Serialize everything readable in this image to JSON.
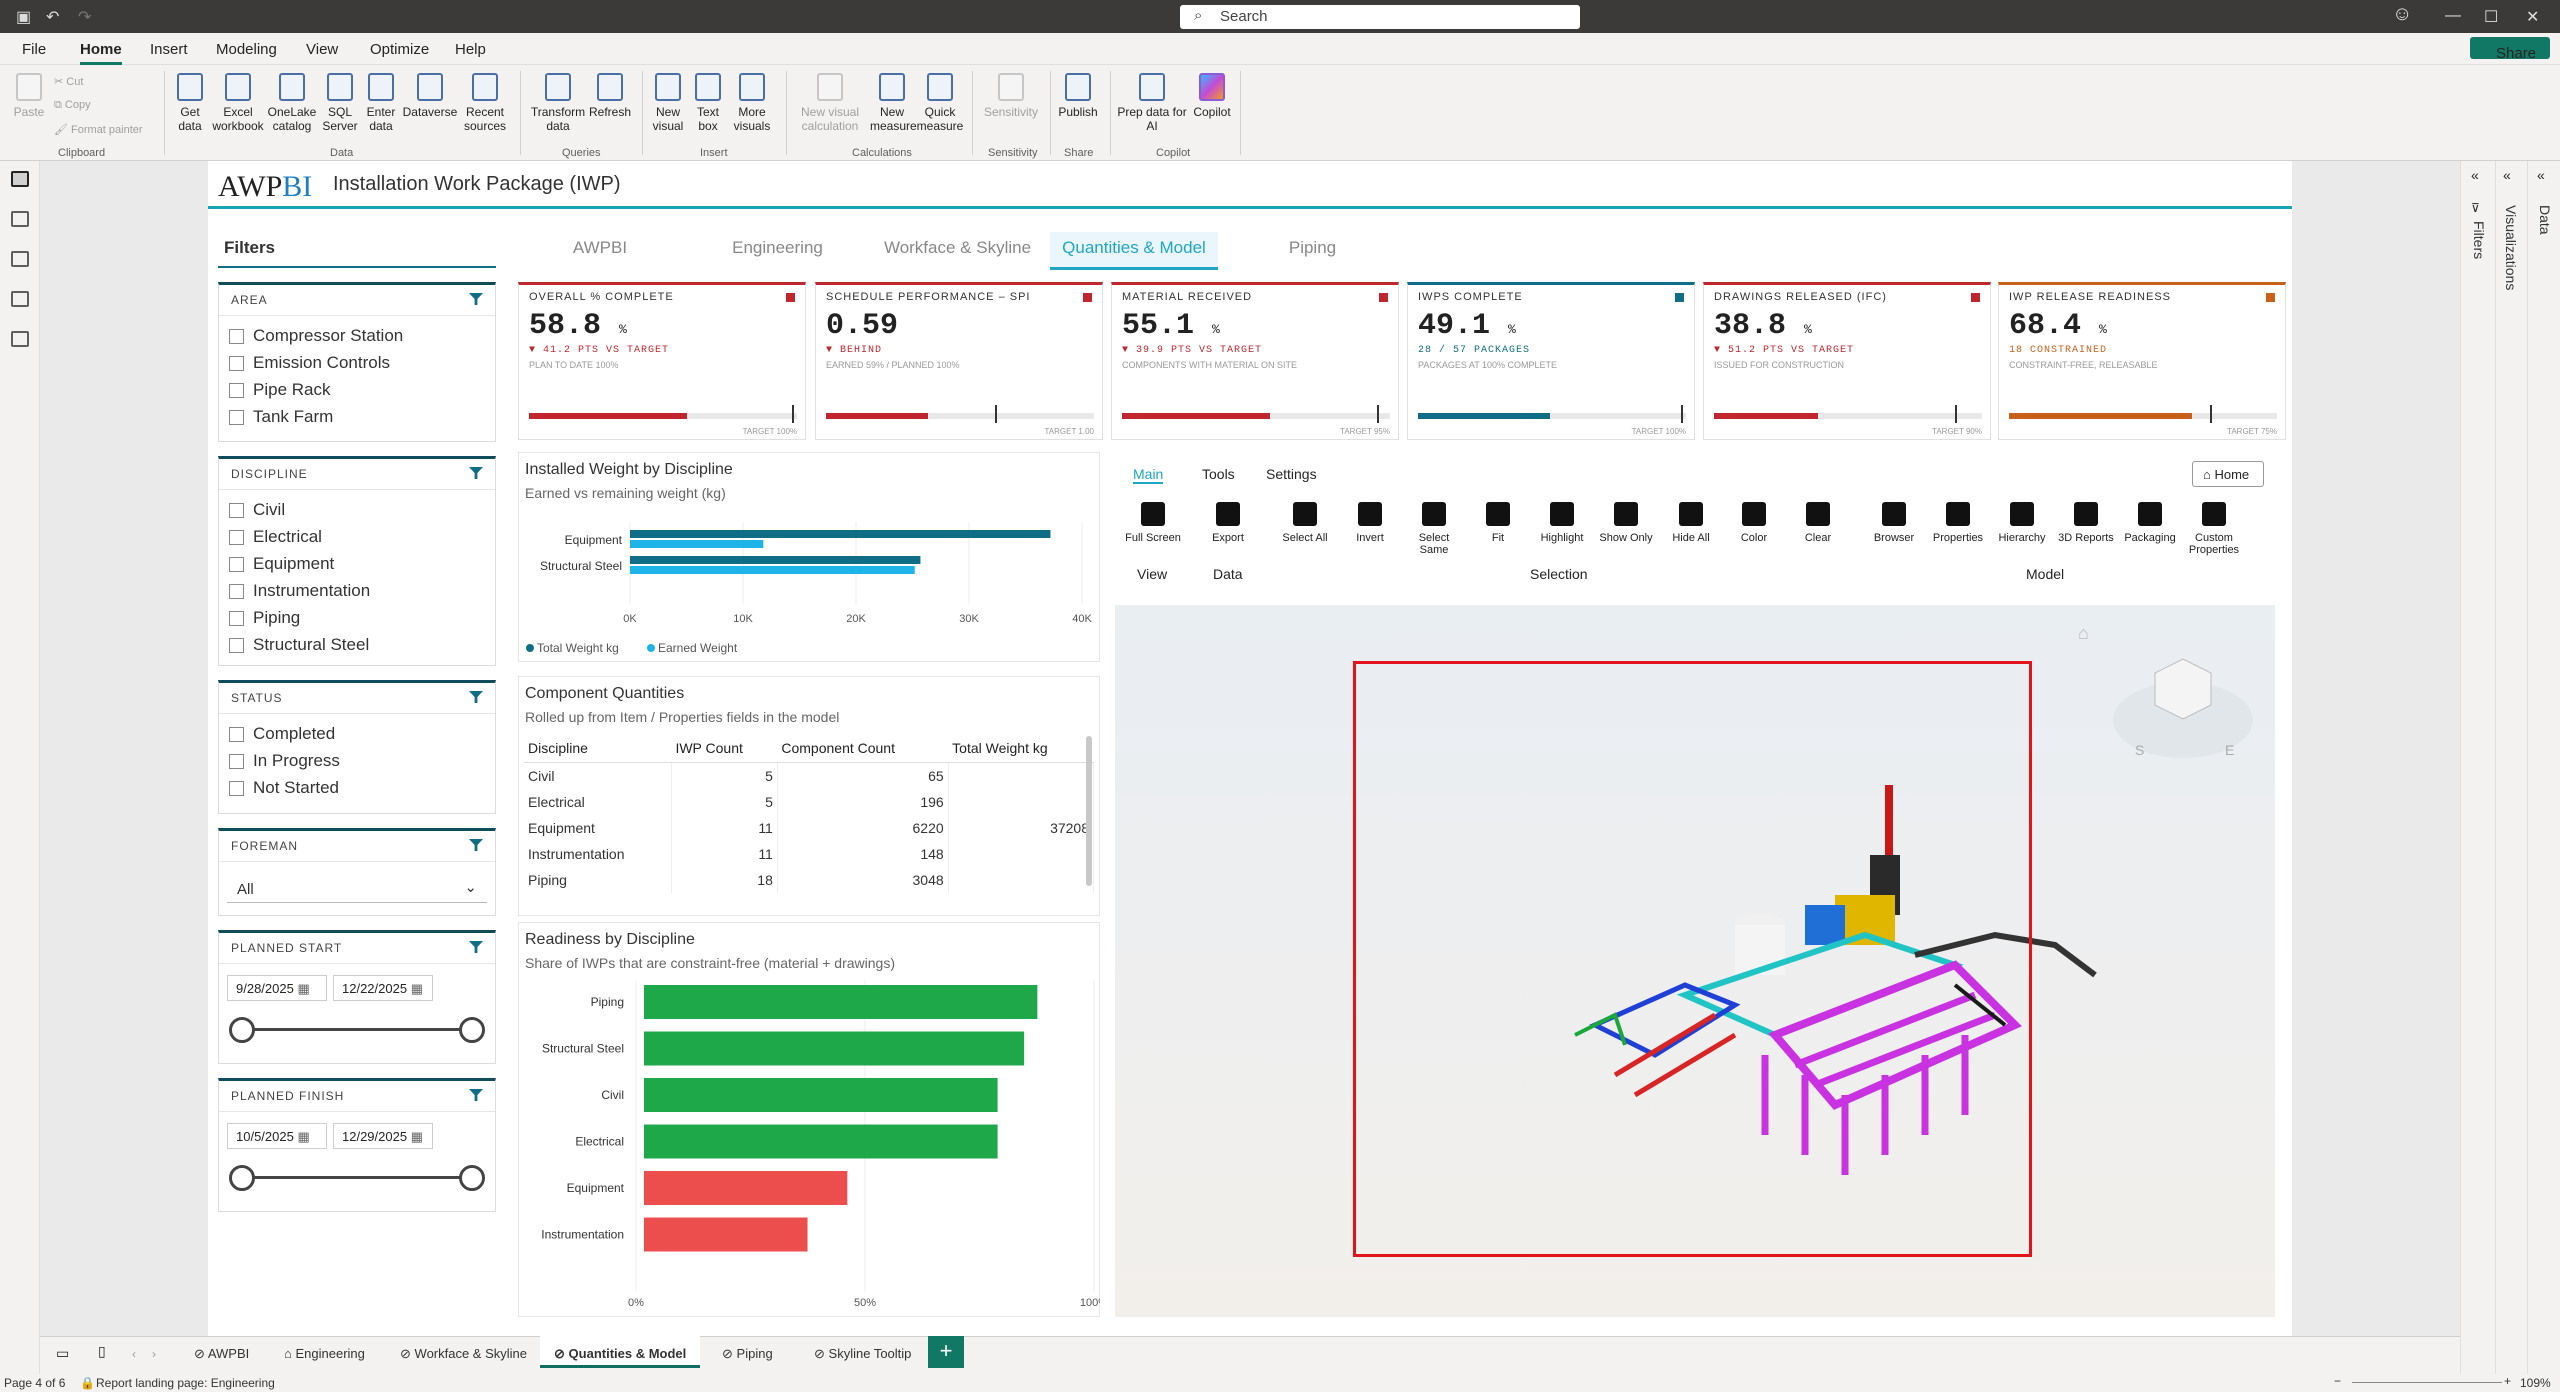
{
  "titlebar": {
    "search_placeholder": "Search",
    "share": "Share"
  },
  "menu": [
    "File",
    "Home",
    "Insert",
    "Modeling",
    "View",
    "Optimize",
    "Help"
  ],
  "ribbon": {
    "clipboard": {
      "paste": "Paste",
      "cut": "Cut",
      "copy": "Copy",
      "format_painter": "Format painter",
      "group": "Clipboard"
    },
    "data_buttons": [
      "Get data",
      "Excel workbook",
      "OneLake catalog",
      "SQL Server",
      "Enter data",
      "Dataverse",
      "Recent sources"
    ],
    "data_group": "Data",
    "query_buttons": [
      "Transform data",
      "Refresh"
    ],
    "query_group": "Queries",
    "insert_buttons": [
      "New visual",
      "Text box",
      "More visuals"
    ],
    "insert_group": "Insert",
    "calc_buttons": [
      "New visual calculation",
      "New measure",
      "Quick measure"
    ],
    "calc_group": "Calculations",
    "sensitivity_button": "Sensitivity",
    "sensitivity_group": "Sensitivity",
    "publish_button": "Publish",
    "share_group": "Share",
    "copilot_buttons": [
      "Prep data for AI",
      "Copilot"
    ],
    "copilot_group": "Copilot"
  },
  "report": {
    "logo_a": "AWP",
    "logo_b": "BI",
    "title": "Installation Work Package (IWP)",
    "tabs": [
      "AWPBI",
      "Engineering",
      "Workface & Skyline",
      "Quantities & Model",
      "Piping"
    ],
    "active_tab": "Quantities & Model"
  },
  "filters": {
    "heading": "Filters",
    "area": {
      "label": "AREA",
      "items": [
        "Compressor Station",
        "Emission Controls",
        "Pipe Rack",
        "Tank Farm"
      ]
    },
    "discipline": {
      "label": "DISCIPLINE",
      "items": [
        "Civil",
        "Electrical",
        "Equipment",
        "Instrumentation",
        "Piping",
        "Structural Steel"
      ]
    },
    "status": {
      "label": "STATUS",
      "items": [
        "Completed",
        "In Progress",
        "Not Started"
      ]
    },
    "foreman": {
      "label": "FOREMAN",
      "value": "All"
    },
    "planned_start": {
      "label": "PLANNED START",
      "from": "9/28/2025",
      "to": "12/22/2025"
    },
    "planned_finish": {
      "label": "PLANNED FINISH",
      "from": "10/5/2025",
      "to": "12/29/2025"
    }
  },
  "kpis": [
    {
      "label": "OVERALL % COMPLETE",
      "value": "58.8",
      "unit": "%",
      "delta": "▼ 41.2 PTS VS TARGET",
      "sub": "PLAN TO DATE 100%",
      "target": "TARGET 100%",
      "fill": 0.588,
      "tpos": 0.98,
      "color": "#c0262d"
    },
    {
      "label": "SCHEDULE PERFORMANCE – SPI",
      "value": "0.59",
      "unit": "",
      "delta": "▼ BEHIND",
      "sub": "EARNED 59% / PLANNED 100%",
      "target": "TARGET 1.00",
      "fill": 0.38,
      "tpos": 0.63,
      "color": "#c0262d"
    },
    {
      "label": "MATERIAL RECEIVED",
      "value": "55.1",
      "unit": "%",
      "delta": "▼ 39.9 PTS VS TARGET",
      "sub": "COMPONENTS WITH MATERIAL ON SITE",
      "target": "TARGET 95%",
      "fill": 0.551,
      "tpos": 0.95,
      "color": "#c0262d"
    },
    {
      "label": "IWPS COMPLETE",
      "value": "49.1",
      "unit": "%",
      "delta": "28 / 57 PACKAGES",
      "sub": "PACKAGES AT 100% COMPLETE",
      "target": "TARGET 100%",
      "fill": 0.491,
      "tpos": 0.98,
      "color": "#0f6e86"
    },
    {
      "label": "DRAWINGS RELEASED (IFC)",
      "value": "38.8",
      "unit": "%",
      "delta": "▼ 51.2 PTS VS TARGET",
      "sub": "ISSUED FOR CONSTRUCTION",
      "target": "TARGET 90%",
      "fill": 0.388,
      "tpos": 0.9,
      "color": "#c0262d"
    },
    {
      "label": "IWP RELEASE READINESS",
      "value": "68.4",
      "unit": "%",
      "delta": "18 CONSTRAINED",
      "sub": "CONSTRAINT-FREE, RELEASABLE",
      "target": "TARGET 75%",
      "fill": 0.684,
      "tpos": 0.75,
      "color": "#c8601a"
    }
  ],
  "installed_weight": {
    "title": "Installed Weight by Discipline",
    "subtitle": "Earned vs remaining weight (kg)"
  },
  "component_quantities": {
    "title": "Component Quantities",
    "subtitle": "Rolled up from Item / Properties fields in the model",
    "headers": [
      "Discipline",
      "IWP Count",
      "Component Count",
      "Total Weight kg"
    ],
    "rows": [
      [
        "Civil",
        "5",
        "65",
        ""
      ],
      [
        "Electrical",
        "5",
        "196",
        ""
      ],
      [
        "Equipment",
        "11",
        "6220",
        "37208"
      ],
      [
        "Instrumentation",
        "11",
        "148",
        ""
      ],
      [
        "Piping",
        "18",
        "3048",
        ""
      ]
    ]
  },
  "readiness": {
    "title": "Readiness by Discipline",
    "subtitle": "Share of IWPs that are constraint-free (material + drawings)"
  },
  "viewer": {
    "tabs": [
      "Main",
      "Tools",
      "Settings"
    ],
    "home": "Home",
    "tools": [
      {
        "label": "Full Screen",
        "icon": "fullscreen-icon"
      },
      {
        "label": "Export",
        "icon": "export-icon"
      },
      {
        "label": "Select All",
        "icon": "select-all-icon"
      },
      {
        "label": "Invert",
        "icon": "invert-icon"
      },
      {
        "label": "Select Same",
        "icon": "select-same-icon"
      },
      {
        "label": "Fit",
        "icon": "fit-icon"
      },
      {
        "label": "Highlight",
        "icon": "highlight-icon"
      },
      {
        "label": "Show Only",
        "icon": "eye-icon"
      },
      {
        "label": "Hide All",
        "icon": "eye-off-icon"
      },
      {
        "label": "Color",
        "icon": "palette-icon"
      },
      {
        "label": "Clear",
        "icon": "eraser-icon"
      },
      {
        "label": "Browser",
        "icon": "tree-icon"
      },
      {
        "label": "Properties",
        "icon": "list-icon"
      },
      {
        "label": "Hierarchy",
        "icon": "hierarchy-icon"
      },
      {
        "label": "3D Reports",
        "icon": "report-icon"
      },
      {
        "label": "Packaging",
        "icon": "package-icon"
      },
      {
        "label": "Custom Properties",
        "icon": "tag-icon"
      }
    ],
    "groups": [
      "View",
      "Data",
      "Selection",
      "Model"
    ]
  },
  "page_tabs": [
    "AWPBI",
    "Engineering",
    "Workface & Skyline",
    "Quantities & Model",
    "Piping",
    "Skyline Tooltip"
  ],
  "status": {
    "page": "Page 4 of 6",
    "landing": "Report landing page: Engineering",
    "zoom": "109%"
  },
  "right_panes": {
    "filters": "Filters",
    "visualizations": "Visualizations",
    "data": "Data"
  },
  "chart_data": [
    {
      "type": "bar",
      "title": "Installed Weight by Discipline",
      "categories": [
        "Equipment",
        "Structural Steel"
      ],
      "series": [
        {
          "name": "Total Weight kg",
          "values": [
            37208,
            25700
          ],
          "color": "#0f6e86"
        },
        {
          "name": "Earned Weight",
          "values": [
            11800,
            25200
          ],
          "color": "#1fb4e8"
        }
      ],
      "xlim": [
        0,
        40000
      ],
      "ticks": [
        "0K",
        "10K",
        "20K",
        "30K",
        "40K"
      ],
      "legend": "bottom-left"
    },
    {
      "type": "bar",
      "title": "Readiness by Discipline",
      "categories": [
        "Piping",
        "Structural Steel",
        "Civil",
        "Electrical",
        "Equipment",
        "Instrumentation"
      ],
      "values": [
        0.89,
        0.86,
        0.8,
        0.8,
        0.46,
        0.37
      ],
      "colors": [
        "#1ea84a",
        "#1ea84a",
        "#1ea84a",
        "#1ea84a",
        "#ec4d4d",
        "#ec4d4d"
      ],
      "xlim": [
        0,
        1
      ],
      "ticks": [
        "0%",
        "50%",
        "100%"
      ]
    }
  ]
}
